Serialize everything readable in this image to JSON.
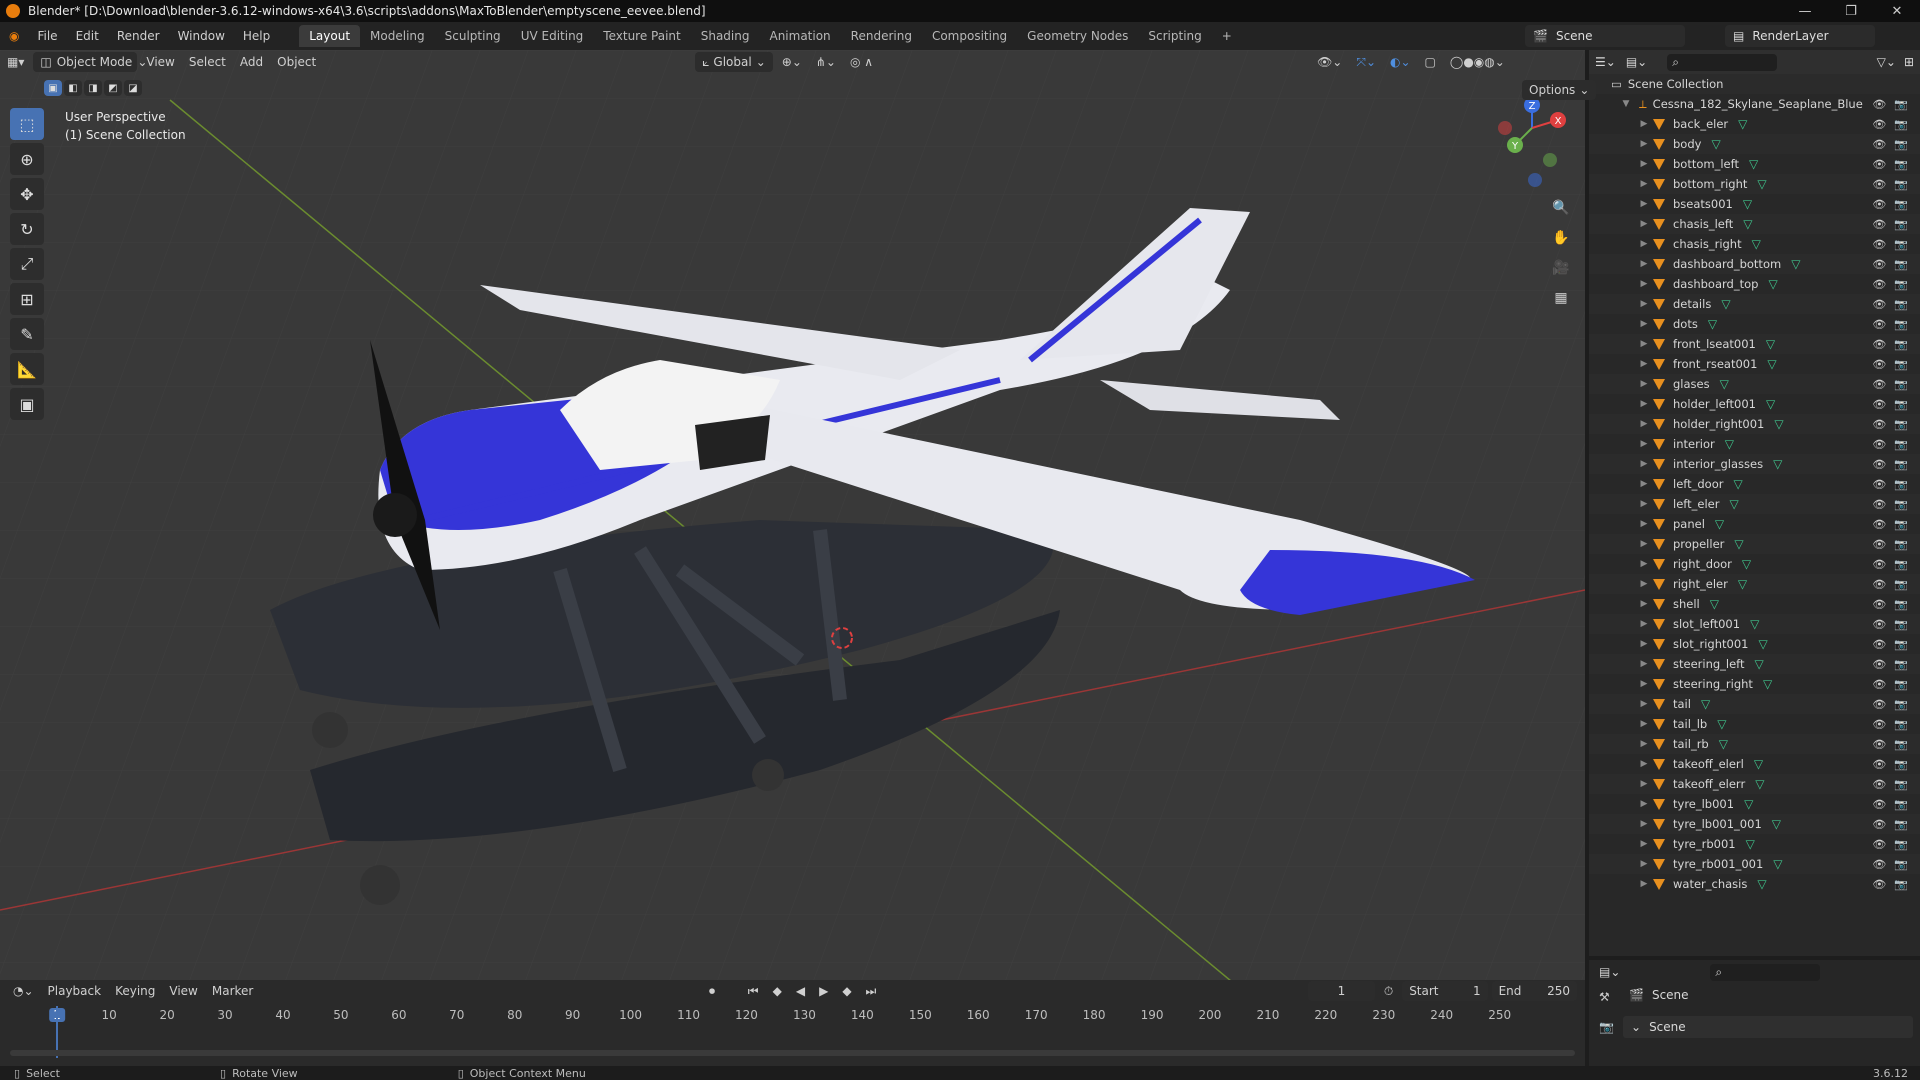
{
  "window": {
    "title": "Blender* [D:\\Download\\blender-3.6.12-windows-x64\\3.6\\scripts\\addons\\MaxToBlender\\emptyscene_eevee.blend]"
  },
  "menu": [
    "File",
    "Edit",
    "Render",
    "Window",
    "Help"
  ],
  "workspaces": [
    "Layout",
    "Modeling",
    "Sculpting",
    "UV Editing",
    "Texture Paint",
    "Shading",
    "Animation",
    "Rendering",
    "Compositing",
    "Geometry Nodes",
    "Scripting"
  ],
  "active_workspace": "Layout",
  "scene_name": "Scene",
  "render_layer": "RenderLayer",
  "viewport_header": {
    "mode": "Object Mode",
    "view": "View",
    "select": "Select",
    "add": "Add",
    "object": "Object",
    "transform_orientation": "Global",
    "options": "Options"
  },
  "viewport_overlay": {
    "perspective": "User Perspective",
    "collection": "(1) Scene Collection"
  },
  "gizmo_axes": {
    "x": "X",
    "y": "Y",
    "z": "Z"
  },
  "outliner": {
    "root": "Scene Collection",
    "parent": "Cessna_182_Skylane_Seaplane_Blue",
    "children": [
      "back_eler",
      "body",
      "bottom_left",
      "bottom_right",
      "bseats001",
      "chasis_left",
      "chasis_right",
      "dashboard_bottom",
      "dashboard_top",
      "details",
      "dots",
      "front_lseat001",
      "front_rseat001",
      "glases",
      "holder_left001",
      "holder_right001",
      "interior",
      "interior_glasses",
      "left_door",
      "left_eler",
      "panel",
      "propeller",
      "right_door",
      "right_eler",
      "shell",
      "slot_left001",
      "slot_right001",
      "steering_left",
      "steering_right",
      "tail",
      "tail_lb",
      "tail_rb",
      "takeoff_elerl",
      "takeoff_elerr",
      "tyre_lb001",
      "tyre_lb001_001",
      "tyre_rb001",
      "tyre_rb001_001",
      "water_chasis"
    ]
  },
  "properties": {
    "scene_label": "Scene",
    "panel_label": "Scene"
  },
  "timeline": {
    "menus": [
      "Playback",
      "Keying",
      "View",
      "Marker"
    ],
    "current_frame": "1",
    "start_label": "Start",
    "start": "1",
    "end_label": "End",
    "end": "250",
    "ticks": [
      "1",
      "10",
      "20",
      "30",
      "40",
      "50",
      "60",
      "70",
      "80",
      "90",
      "100",
      "110",
      "120",
      "130",
      "140",
      "150",
      "160",
      "170",
      "180",
      "190",
      "200",
      "210",
      "220",
      "230",
      "240",
      "250"
    ]
  },
  "statusbar": {
    "left": "Select",
    "middle": "Rotate View",
    "right": "Object Context Menu",
    "version": "3.6.12"
  },
  "colors": {
    "accent": "#4772b3",
    "plane_blue": "#3535d8",
    "object_orange": "#e8901f",
    "mesh_green": "#3fc18a"
  }
}
